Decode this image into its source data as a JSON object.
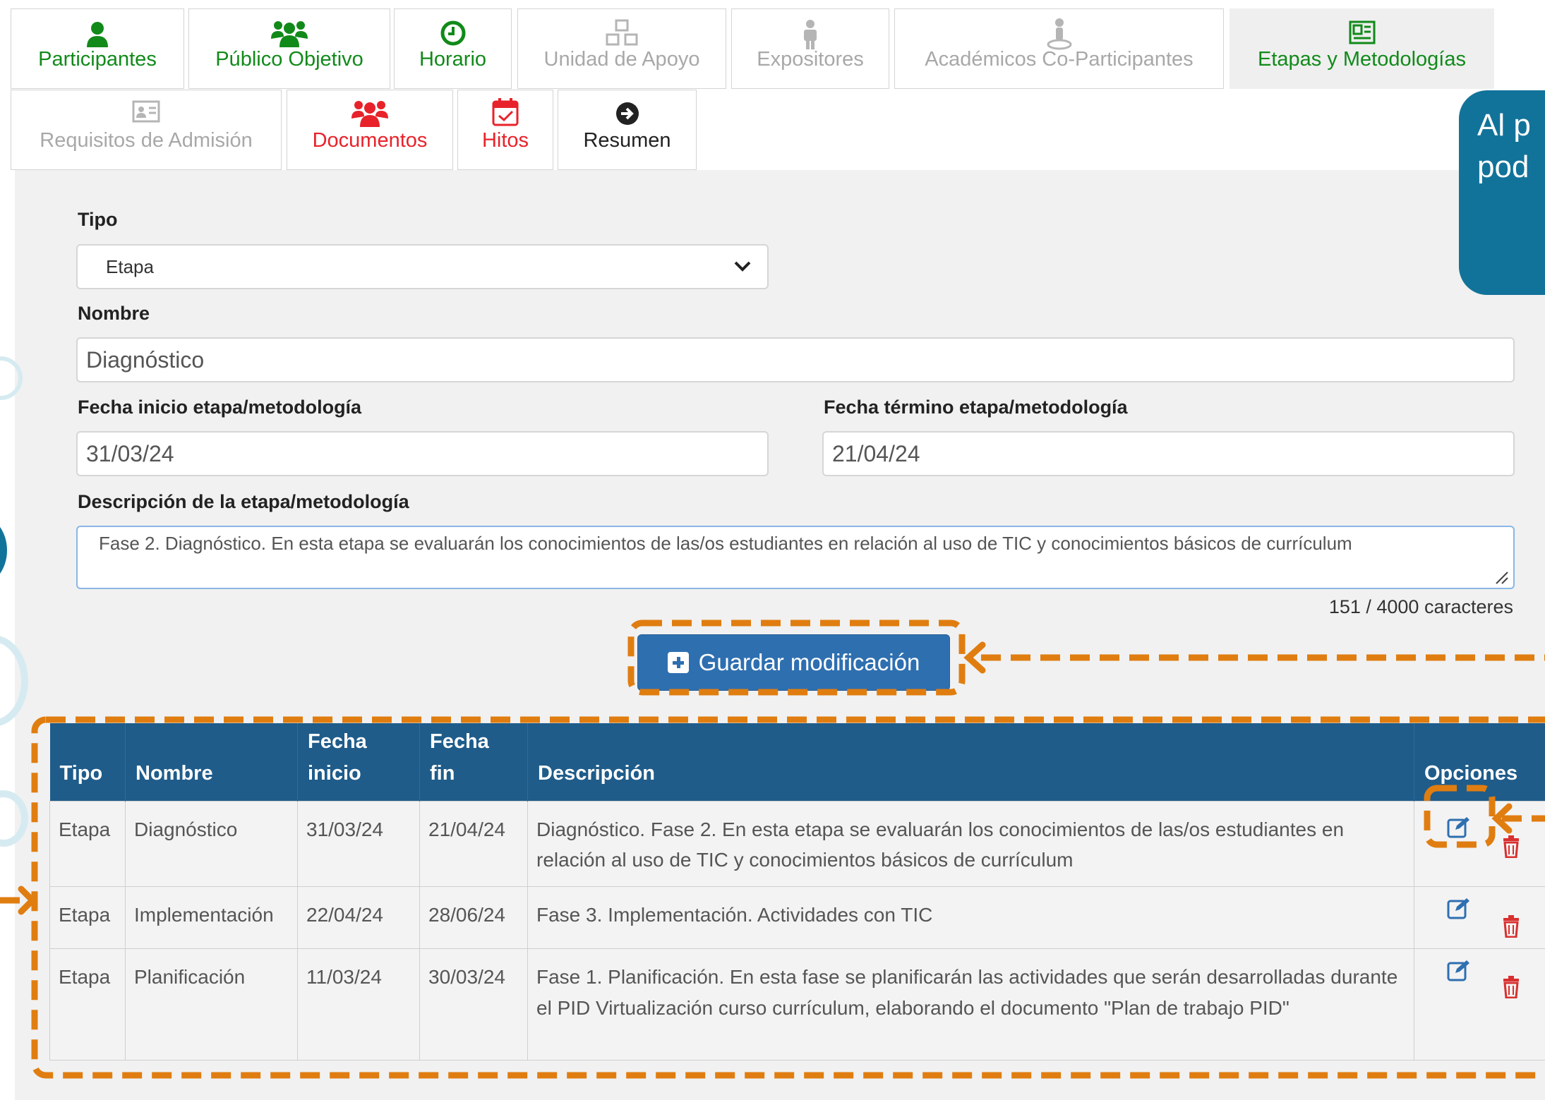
{
  "tabs": [
    {
      "label": "Participantes",
      "icon": "user-icon",
      "state": "green"
    },
    {
      "label": "Público Objetivo",
      "icon": "users-icon",
      "state": "green"
    },
    {
      "label": "Horario",
      "icon": "clock-icon",
      "state": "green"
    },
    {
      "label": "Unidad de Apoyo",
      "icon": "cubes-icon",
      "state": "disabled"
    },
    {
      "label": "Expositores",
      "icon": "presenter-icon",
      "state": "disabled"
    },
    {
      "label": "Académicos Co-Participantes",
      "icon": "person-pin-icon",
      "state": "disabled"
    },
    {
      "label": "Etapas y Metodologías",
      "icon": "newspaper-icon",
      "state": "active"
    },
    {
      "label": "Requisitos de Admisión",
      "icon": "id-card-icon",
      "state": "disabled"
    },
    {
      "label": "Documentos",
      "icon": "users-icon",
      "state": "red"
    },
    {
      "label": "Hitos",
      "icon": "calendar-check-icon",
      "state": "red"
    },
    {
      "label": "Resumen",
      "icon": "arrow-circle-icon",
      "state": "dark"
    }
  ],
  "form": {
    "tipo_label": "Tipo",
    "tipo_value": "Etapa",
    "nombre_label": "Nombre",
    "nombre_value": "Diagnóstico",
    "fecha_inicio_label": "Fecha inicio etapa/metodología",
    "fecha_inicio_value": "31/03/24",
    "fecha_termino_label": "Fecha término etapa/metodología",
    "fecha_termino_value": "21/04/24",
    "descripcion_label": "Descripción de la etapa/metodología",
    "descripcion_value": "Fase 2. Diagnóstico. En esta etapa se evaluarán los conocimientos de las/os estudiantes en relación al uso de TIC y conocimientos básicos de currículum",
    "counter": "151 / 4000 caracteres",
    "save_label": "Guardar modificación"
  },
  "table": {
    "headers": {
      "tipo": "Tipo",
      "nombre": "Nombre",
      "fecha_inicio_1": "Fecha",
      "fecha_inicio_2": "inicio",
      "fecha_fin_1": "Fecha",
      "fecha_fin_2": "fin",
      "descripcion": "Descripción",
      "opciones": "Opciones"
    },
    "rows": [
      {
        "tipo": "Etapa",
        "nombre": "Diagnóstico",
        "inicio": "31/03/24",
        "fin": "21/04/24",
        "descripcion": "Diagnóstico. Fase 2. En esta etapa se evaluarán los conocimientos de las/os estudiantes en relación al uso de TIC y conocimientos básicos de currículum"
      },
      {
        "tipo": "Etapa",
        "nombre": "Implementación",
        "inicio": "22/04/24",
        "fin": "28/06/24",
        "descripcion": "Fase 3. Implementación. Actividades con TIC"
      },
      {
        "tipo": "Etapa",
        "nombre": "Planificación",
        "inicio": "11/03/24",
        "fin": "30/03/24",
        "descripcion": "Fase 1. Planificación. En esta fase se planificarán las actividades que serán desarrolladas durante el PID Virtualización curso currículum, elaborando el documento \"Plan de trabajo PID\""
      }
    ]
  },
  "callout": {
    "line1": "Al p",
    "line2": "pod"
  },
  "colors": {
    "green": "#118a1a",
    "red": "#e8222a",
    "header_blue": "#1f5c8a",
    "button_blue": "#2e6fb0",
    "highlight_orange": "#e07d10",
    "callout_teal": "#12739a"
  }
}
